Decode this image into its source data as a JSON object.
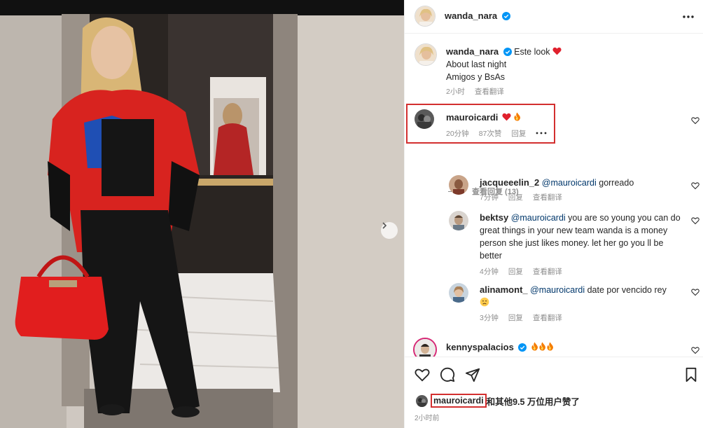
{
  "post": {
    "author": "wanda_nara",
    "more_options_icon": "more-horizontal-icon"
  },
  "caption": {
    "username": "wanda_nara",
    "line1": "Este look",
    "line2": "About last night",
    "line3": "Amigos y BsAs",
    "time": "2小时",
    "translate": "查看翻译"
  },
  "comments": [
    {
      "username": "mauroicardi",
      "text": "",
      "time": "20分钟",
      "likes": "87次赞",
      "reply": "回复"
    }
  ],
  "view_replies": "查看回复 (13)",
  "replies": [
    {
      "username": "jacqueeelin_2",
      "mention": "@mauroicardi",
      "text": " gorreado",
      "time": "7分钟",
      "reply": "回复",
      "translate": "查看翻译"
    },
    {
      "username": "bektsy",
      "mention": "@mauroicardi",
      "text": " you are so young you can do great things in your new team wanda is a money person she just likes money. let her go you ll be better",
      "time": "4分钟",
      "reply": "回复",
      "translate": "查看翻译"
    },
    {
      "username": "alinamont_",
      "mention": "@mauroicardi",
      "text": " date por vencido rey",
      "time": "3分钟",
      "reply": "回复",
      "translate": "查看翻译"
    }
  ],
  "last_comment": {
    "username": "kennyspalacios"
  },
  "footer": {
    "liked_by_user": "mauroicardi",
    "liked_by_rest": "和其他9.5 万位用户赞了",
    "time_ago": "2小时前"
  },
  "colors": {
    "verified": "#0095f6",
    "heart_red": "#ed4956",
    "highlight_red": "#d32f2f",
    "meta_gray": "#8e8e8e"
  }
}
